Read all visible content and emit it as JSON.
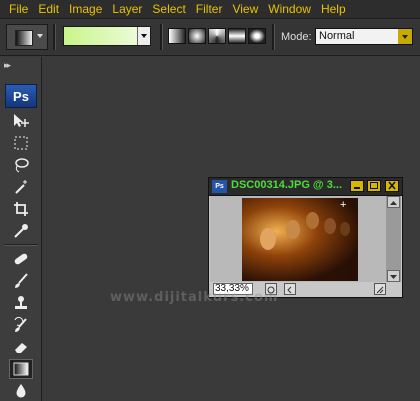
{
  "menu": [
    "File",
    "Edit",
    "Image",
    "Layer",
    "Select",
    "Filter",
    "View",
    "Window",
    "Help"
  ],
  "options_bar": {
    "tool_preset_icon": "gradient-tool-icon",
    "gradient_colors": [
      "#c9f58a",
      "#f2fce4"
    ],
    "gradient_types": [
      "linear",
      "radial",
      "angle",
      "reflected",
      "diamond"
    ],
    "mode_label": "Mode:",
    "mode_value": "Normal"
  },
  "toolbox": {
    "logo": "Ps",
    "tools": [
      "move",
      "marquee",
      "lasso",
      "magic-wand",
      "crop",
      "eyedropper",
      "healing-brush",
      "brush",
      "clone-stamp",
      "history-brush",
      "eraser",
      "gradient",
      "blur"
    ],
    "selected_tool": "gradient"
  },
  "document": {
    "title": "DSC00314.JPG @ 3...",
    "icon_label": "Ps",
    "zoom": "33,33%"
  },
  "watermark": "www.dijitalkurs.com",
  "colors": {
    "menu_text": "#e8c200",
    "title_text": "#4fdc3c",
    "background": "#3a3a3a",
    "accent": "#d7b800"
  }
}
